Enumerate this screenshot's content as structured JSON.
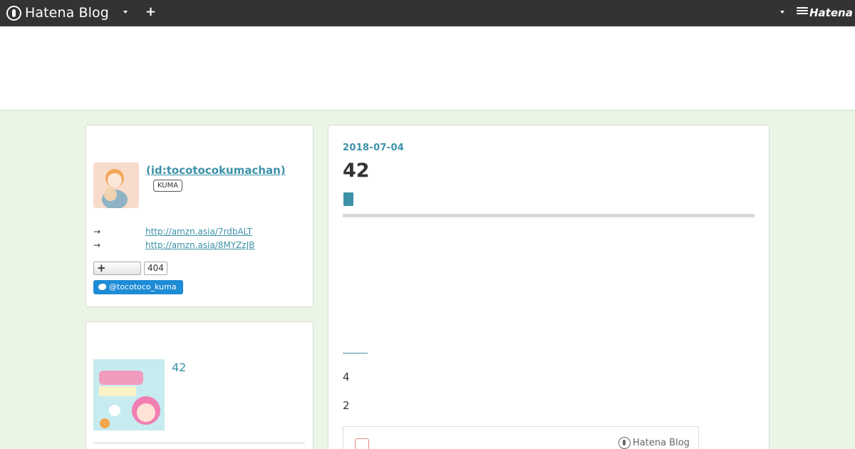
{
  "topbar": {
    "brand": "Hatena Blog",
    "plus": "+",
    "hatena": "Hatena"
  },
  "profile": {
    "name": " (id:tocotocokumachan)",
    "badge": "KUMA",
    "links": [
      {
        "arrow": "→",
        "url": "http://amzn.asia/7rdbALT"
      },
      {
        "arrow": "→",
        "url": "http://amzn.asia/8MYZzJB"
      }
    ],
    "follow_icon": "+",
    "follow_count": "404",
    "twitter": "@tocotoco_kuma"
  },
  "recent": {
    "title": "42"
  },
  "entry": {
    "date": "2018-07-04",
    "title": "42",
    "paragraphs": [
      "4",
      "2"
    ],
    "embed_brand": "Hatena Blog"
  },
  "colors": {
    "accent": "#3d92a8",
    "topbar": "#333333",
    "background": "#eaf5e6",
    "twitter": "#1d8bd6"
  }
}
